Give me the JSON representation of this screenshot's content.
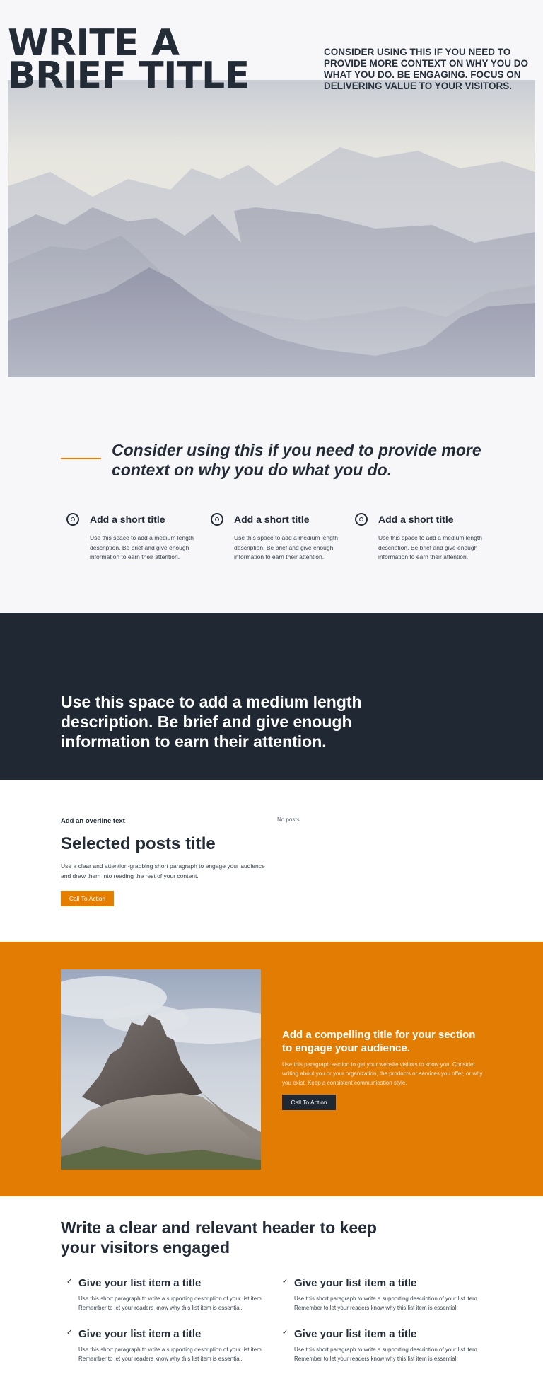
{
  "hero": {
    "title": "WRITE A BRIEF TITLE",
    "side_text": "CONSIDER USING THIS IF YOU NEED TO PROVIDE MORE CONTEXT ON WHY YOU DO WHAT YOU DO. BE ENGAGING. FOCUS ON DELIVERING VALUE TO YOUR VISITORS."
  },
  "features": {
    "quote": "Consider using this if you need to provide more context on why you do what you do.",
    "items": [
      {
        "icon": "target-icon",
        "title": "Add a short title",
        "desc": "Use this space to add a medium length description. Be brief and give enough information to earn their attention."
      },
      {
        "icon": "target-icon",
        "title": "Add a short title",
        "desc": "Use this space to add a medium length description. Be brief and give enough information to earn their attention."
      },
      {
        "icon": "target-icon",
        "title": "Add a short title",
        "desc": "Use this space to add a medium length description. Be brief and give enough information to earn their attention."
      }
    ]
  },
  "banner": {
    "text": "Use this space to add a medium length description. Be brief and give enough information to earn their attention."
  },
  "posts": {
    "overline": "Add an overline text",
    "title": "Selected posts title",
    "desc": "Use a clear and attention-grabbing short paragraph to engage your audience and draw them into reading the rest of your content.",
    "cta": "Call To Action",
    "empty": "No posts"
  },
  "promo": {
    "title": "Add a compelling title for your section to engage your audience.",
    "desc": "Use this paragraph section to get your website visitors to know you. Consider writing about you or your organization, the products or services you offer, or why you exist. Keep a consistent communication style.",
    "cta": "Call To Action"
  },
  "list": {
    "header": "Write a clear and relevant header to keep your visitors engaged",
    "items": [
      {
        "title": "Give your list item a title",
        "desc": "Use this short paragraph to write a supporting description of your list item. Remember to let your readers know why this list item is essential."
      },
      {
        "title": "Give your list item a title",
        "desc": "Use this short paragraph to write a supporting description of your list item. Remember to let your readers know why this list item is essential."
      },
      {
        "title": "Give your list item a title",
        "desc": "Use this short paragraph to write a supporting description of your list item. Remember to let your readers know why this list item is essential."
      },
      {
        "title": "Give your list item a title",
        "desc": "Use this short paragraph to write a supporting description of your list item. Remember to let your readers know why this list item is essential."
      }
    ]
  },
  "colors": {
    "accent": "#e47d00",
    "dark": "#1f2833",
    "background": "#f7f7f9"
  }
}
